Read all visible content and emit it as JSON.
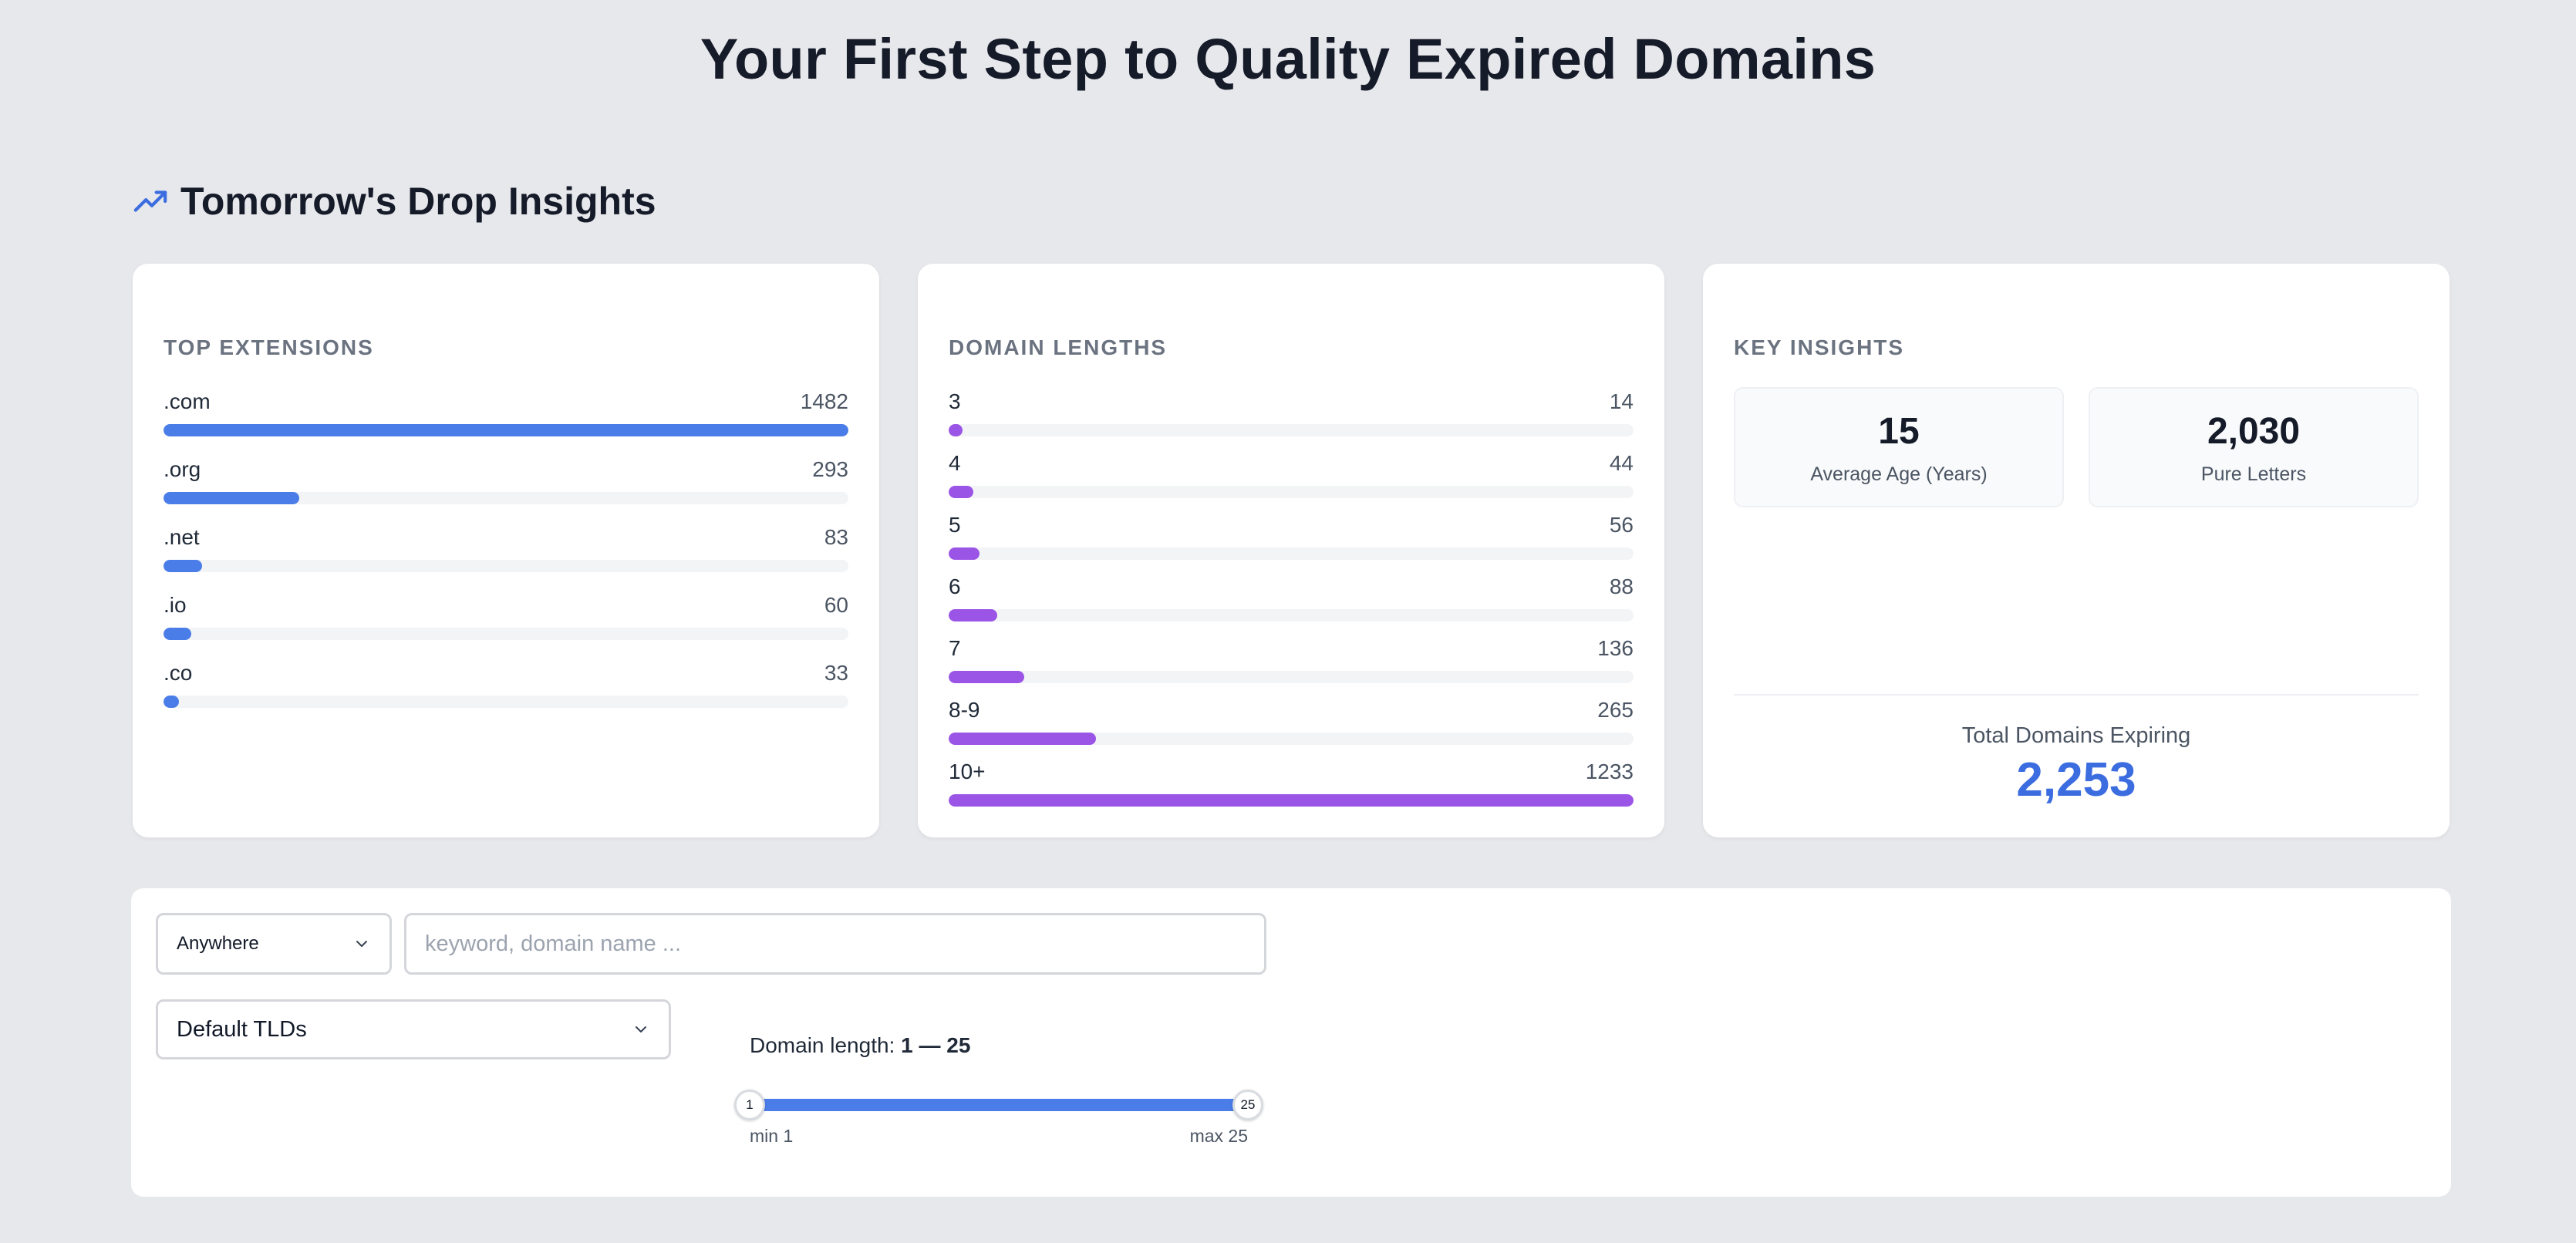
{
  "page": {
    "title": "Your First Step to Quality Expired Domains"
  },
  "insights": {
    "heading": "Tomorrow's Drop Insights",
    "heading_icon": "trend-up-icon",
    "accent_color": "#3c6de0"
  },
  "top_extensions": {
    "title": "TOP EXTENSIONS",
    "bar_color": "#4a7de8",
    "max": 1482,
    "items": [
      {
        "label": ".com",
        "count": 1482
      },
      {
        "label": ".org",
        "count": 293
      },
      {
        "label": ".net",
        "count": 83
      },
      {
        "label": ".io",
        "count": 60
      },
      {
        "label": ".co",
        "count": 33
      }
    ]
  },
  "domain_lengths": {
    "title": "DOMAIN LENGTHS",
    "bar_color": "#9b55e6",
    "max": 1233,
    "items": [
      {
        "label": "3",
        "count": 14
      },
      {
        "label": "4",
        "count": 44
      },
      {
        "label": "5",
        "count": 56
      },
      {
        "label": "6",
        "count": 88
      },
      {
        "label": "7",
        "count": 136
      },
      {
        "label": "8-9",
        "count": 265
      },
      {
        "label": "10+",
        "count": 1233
      }
    ]
  },
  "key_insights": {
    "title": "KEY INSIGHTS",
    "average_age": {
      "value": "15",
      "label": "Average Age (Years)"
    },
    "pure_letters": {
      "value": "2,030",
      "label": "Pure Letters"
    },
    "total": {
      "label": "Total Domains Expiring",
      "value": "2,253"
    }
  },
  "search": {
    "scope_select": "Anywhere",
    "keyword_placeholder": "keyword, domain name ...",
    "keyword_value": "",
    "tld_select": "Default TLDs",
    "length_label": "Domain length:",
    "length_range": "1 — 25",
    "slider": {
      "min_knob": "1",
      "max_knob": "25",
      "min_label": "min 1",
      "max_label": "max 25",
      "min": 1,
      "max": 25,
      "value_low": 1,
      "value_high": 25
    }
  }
}
